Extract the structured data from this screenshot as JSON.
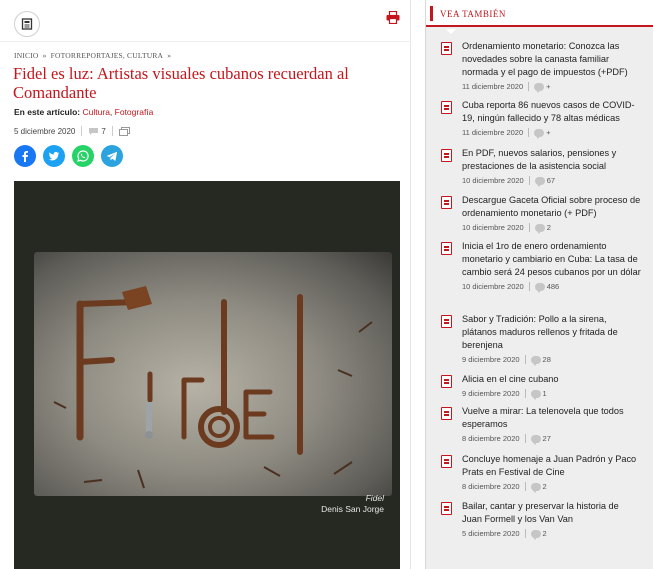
{
  "article": {
    "breadcrumb": [
      "INICIO",
      "»",
      "FOTORREPORTAJES, CULTURA",
      "»"
    ],
    "title": "Fidel es luz: Artistas visuales cubanos recuerdan al Comandante",
    "in_article_label": "En este artículo:",
    "tags": [
      "Cultura",
      "Fotografía"
    ],
    "date": "5 diciembre 2020",
    "comments": "7",
    "photo_caption_title": "Fidel",
    "photo_caption_author": "Denis San Jorge",
    "social": {
      "facebook_icon": "facebook-icon",
      "twitter_icon": "twitter-icon",
      "whatsapp_icon": "whatsapp-icon",
      "telegram_icon": "telegram-icon"
    }
  },
  "sidebar": {
    "title": "VEA TAMBIÉN",
    "items": [
      {
        "title": "Ordenamiento monetario: Conozca las novedades sobre la canasta familiar normada y el pago de impuestos (+PDF)",
        "date": "11 diciembre 2020",
        "comments": "+"
      },
      {
        "title": "Cuba reporta 86 nuevos casos de COVID-19, ningún fallecido y 78 altas médicas",
        "date": "11 diciembre 2020",
        "comments": "+"
      },
      {
        "title": "En PDF, nuevos salarios, pensiones y prestaciones de la asistencia social",
        "date": "10 diciembre 2020",
        "comments": "67"
      },
      {
        "title": "Descargue Gaceta Oficial sobre proceso de ordenamiento monetario (+ PDF)",
        "date": "10 diciembre 2020",
        "comments": "2"
      },
      {
        "title": "Inicia el 1ro de enero ordenamiento monetario y cambiario en Cuba: La tasa de cambio será 24 pesos cubanos por un dólar",
        "date": "10 diciembre 2020",
        "comments": "486"
      },
      {
        "title": "Sabor y Tradición: Pollo a la sirena, plátanos maduros rellenos y fritada de berenjena",
        "date": "9 diciembre 2020",
        "comments": "28"
      },
      {
        "title": "Alicia en el cine cubano",
        "date": "9 diciembre 2020",
        "comments": "1"
      },
      {
        "title": "Vuelve a mirar: La telenovela que todos esperamos",
        "date": "8 diciembre 2020",
        "comments": "27"
      },
      {
        "title": "Concluye homenaje a Juan Padrón y Paco Prats en Festival de Cine",
        "date": "8 diciembre 2020",
        "comments": "2"
      },
      {
        "title": "Bailar, cantar y preservar la historia de Juan Formell y los Van Van",
        "date": "5 diciembre 2020",
        "comments": "2"
      }
    ]
  },
  "colors": {
    "accent": "#c4161c",
    "facebook": "#1877f2",
    "twitter": "#1da1f2",
    "whatsapp": "#25d366",
    "telegram": "#2aa3df"
  }
}
